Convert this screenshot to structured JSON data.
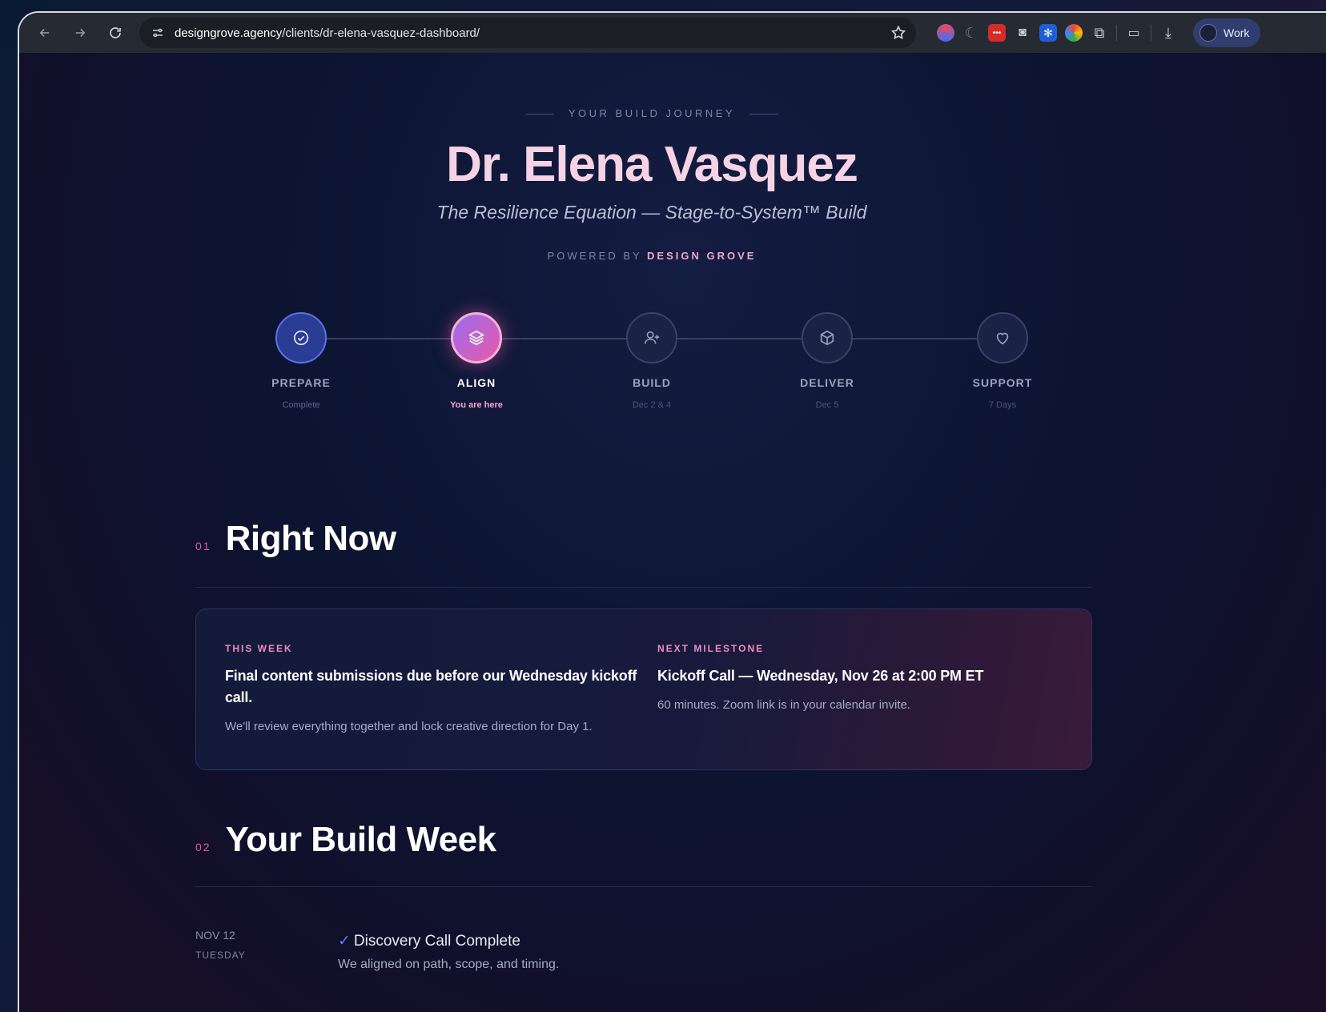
{
  "browser": {
    "url_host": "designgrove.agency",
    "url_path": "/clients/dr-elena-vasquez-dashboard/",
    "profile_label": "Work",
    "extensions": [
      "color-picker-icon",
      "refresh-ext-icon",
      "dots-ext-icon",
      "camera-icon",
      "gear-ext-icon",
      "chrome-ext-icon",
      "puzzle-icon"
    ]
  },
  "hero": {
    "eyebrow": "YOUR BUILD JOURNEY",
    "name": "Dr. Elena Vasquez",
    "tagline": "The Resilience Equation — Stage-to-System™ Build",
    "powered_prefix": "POWERED BY",
    "powered_brand": "DESIGN GROVE"
  },
  "journey": {
    "steps": [
      {
        "label": "PREPARE",
        "sub": "Complete",
        "state": "done",
        "icon": "check-circle-icon"
      },
      {
        "label": "ALIGN",
        "sub": "You are here",
        "state": "active",
        "icon": "layers-icon"
      },
      {
        "label": "BUILD",
        "sub": "Dec 2 & 4",
        "state": "upcoming",
        "icon": "user-plus-icon"
      },
      {
        "label": "DELIVER",
        "sub": "Dec 5",
        "state": "upcoming",
        "icon": "box-icon"
      },
      {
        "label": "SUPPORT",
        "sub": "7 Days",
        "state": "upcoming",
        "icon": "heart-icon"
      }
    ]
  },
  "sections": {
    "right_now": {
      "num": "01",
      "title": "Right Now"
    },
    "build_week": {
      "num": "02",
      "title": "Your Build Week"
    }
  },
  "card": {
    "left": {
      "eyebrow": "THIS WEEK",
      "main": "Final content submissions due before our Wednesday kickoff call.",
      "note": "We'll review everything together and lock creative direction for Day 1."
    },
    "right": {
      "eyebrow": "NEXT MILESTONE",
      "main": "Kickoff Call — Wednesday, Nov 26 at 2:00 PM ET",
      "note": "60 minutes. Zoom link is in your calendar invite."
    }
  },
  "timeline": [
    {
      "date": "NOV 12",
      "day": "TUESDAY",
      "check": "✓",
      "title": "Discovery Call Complete",
      "desc": "We aligned on path, scope, and timing."
    }
  ],
  "colors": {
    "accent_pink": "#e8579f",
    "accent_blue": "#5a73e8",
    "name_pink": "#f6d3e4"
  }
}
